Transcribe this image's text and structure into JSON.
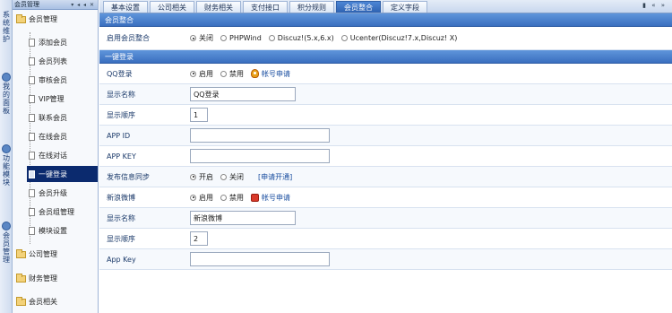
{
  "vstrip": {
    "tabs": [
      {
        "chars": [
          "系",
          "统",
          "维",
          "护"
        ]
      },
      {
        "chars": [
          "我",
          "的",
          "面",
          "板"
        ]
      },
      {
        "chars": [
          "功",
          "能",
          "模",
          "块"
        ]
      },
      {
        "chars": [
          "会",
          "员",
          "管",
          "理"
        ]
      }
    ]
  },
  "sidebar": {
    "header": "会员管理",
    "controls": "▾ ◂ ◂ ✕",
    "group_top": "会员管理",
    "items": [
      {
        "label": "添加会员"
      },
      {
        "label": "会员列表"
      },
      {
        "label": "审核会员"
      },
      {
        "label": "VIP管理"
      },
      {
        "label": "联系会员"
      },
      {
        "label": "在线会员"
      },
      {
        "label": "在线对话"
      },
      {
        "label": "一键登录"
      },
      {
        "label": "会员升级"
      },
      {
        "label": "会员组管理"
      },
      {
        "label": "模块设置"
      }
    ],
    "groups_bottom": [
      {
        "label": "公司管理"
      },
      {
        "label": "财务管理"
      },
      {
        "label": "会员相关"
      }
    ]
  },
  "tabs": [
    {
      "label": "基本设置"
    },
    {
      "label": "公司相关"
    },
    {
      "label": "财务相关"
    },
    {
      "label": "支付接口"
    },
    {
      "label": "积分规则"
    },
    {
      "label": "会员整合"
    },
    {
      "label": "定义字段"
    }
  ],
  "tab_controls": "▮ « »",
  "sections": {
    "integration": "会员整合",
    "oneclick": "一键登录"
  },
  "integration_row": {
    "label": "启用会员整合",
    "options": [
      {
        "text": "关闭",
        "checked": true
      },
      {
        "text": "PHPWind",
        "checked": false
      },
      {
        "text": "Discuz!(5.x,6.x)",
        "checked": false
      },
      {
        "text": "Ucenter(Discuz!7.x,Discuz! X)",
        "checked": false
      }
    ]
  },
  "qq": {
    "login_label": "QQ登录",
    "enable": "启用",
    "disable": "禁用",
    "apply": "帐号申请",
    "name_label": "显示名称",
    "name_value": "QQ登录",
    "order_label": "显示顺序",
    "order_value": "1",
    "appid_label": "APP ID",
    "appid_value": "",
    "appkey_label": "APP KEY",
    "appkey_value": ""
  },
  "sync": {
    "label": "发布信息同步",
    "on": "开启",
    "off": "关闭",
    "apply_link": "[申请开通]"
  },
  "weibo": {
    "label": "新浪微博",
    "enable": "启用",
    "disable": "禁用",
    "apply": "帐号申请",
    "name_label": "显示名称",
    "name_value": "新浪微博",
    "order_label": "显示顺序",
    "order_value": "2",
    "appkey_label": "App Key",
    "appkey_value": ""
  },
  "colors": {
    "accent": "#3a6fbf",
    "sidebar_active": "#0b2a6e"
  }
}
